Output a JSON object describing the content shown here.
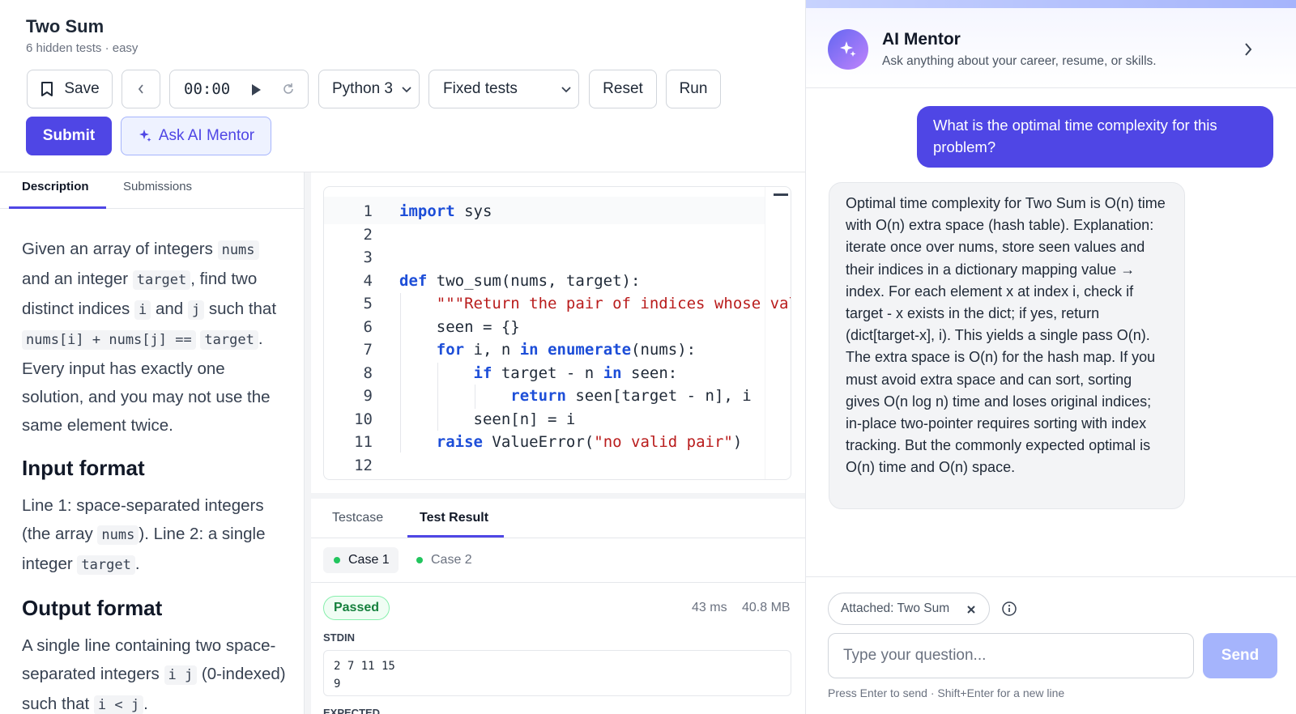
{
  "problem": {
    "title": "Two Sum",
    "subtitle": "6 hidden tests · easy"
  },
  "toolbar": {
    "save_label": "Save",
    "timer": "00:00",
    "language": "Python 3",
    "test_mode": "Fixed tests",
    "reset_label": "Reset",
    "run_label": "Run",
    "submit_label": "Submit",
    "ask_label": "Ask AI Mentor"
  },
  "left_tabs": {
    "description": "Description",
    "submissions": "Submissions"
  },
  "description": {
    "p1": [
      "Given an array of integers ",
      "nums",
      " and an integer ",
      "target",
      ", find two distinct indices ",
      "i",
      " and ",
      "j",
      " such that ",
      "nums[i] + nums[j] ==",
      " ",
      "target",
      ". Every input has exactly one solution, and you may not use the same element twice."
    ],
    "input_heading": "Input format",
    "p2": [
      "Line 1: space-separated integers (the array ",
      "nums",
      "). Line 2: a single integer ",
      "target",
      "."
    ],
    "output_heading": "Output format",
    "p3": [
      "A single line containing two space-separated integers ",
      "i j",
      " (0-indexed) such that ",
      "i < j",
      "."
    ]
  },
  "code": {
    "line_numbers": [
      "1",
      "2",
      "3",
      "4",
      "5",
      "6",
      "7",
      "8",
      "9",
      "10",
      "11",
      "12"
    ]
  },
  "result_tabs": {
    "testcase": "Testcase",
    "test_result": "Test Result"
  },
  "cases": {
    "case1": "Case 1",
    "case2": "Case 2"
  },
  "result": {
    "status": "Passed",
    "runtime": "43 ms",
    "memory": "40.8 MB"
  },
  "io": {
    "stdin_label": "STDIN",
    "stdin_value": "2 7 11 15\n9",
    "expected_label": "EXPECTED"
  },
  "mentor": {
    "title": "AI Mentor",
    "subtitle": "Ask anything about your career, resume, or skills.",
    "user_message": "What is the optimal time complexity for this problem?",
    "bot_message": "Optimal time complexity for Two Sum is O(n) time with O(n) extra space (hash table). Explanation: iterate once over nums, store seen values and their indices in a dictionary mapping value → index. For each element x at index i, check if target - x exists in the dict; if yes, return (dict[target-x], i). This yields a single pass O(n). The extra space is O(n) for the hash map. If you must avoid extra space and can sort, sorting gives O(n log n) time and loses original indices; in-place two-pointer requires sorting with index tracking. But the commonly expected optimal is O(n) time and O(n) space.",
    "attachment": "Attached: Two Sum",
    "input_placeholder": "Type your question...",
    "send_label": "Send",
    "hint": "Press Enter to send · Shift+Enter for a new line"
  },
  "colors": {
    "accent": "#4f46e5",
    "send_disabled": "#a5b4fc",
    "passed": "#15803d",
    "keyword": "#1d4ed8",
    "string": "#b91c1c"
  },
  "icons": [
    "bookmark-icon",
    "chevron-left-icon",
    "play-icon",
    "refresh-icon",
    "chevron-down-icon",
    "sparkle-icon",
    "chevron-right-icon",
    "close-icon",
    "info-icon"
  ]
}
